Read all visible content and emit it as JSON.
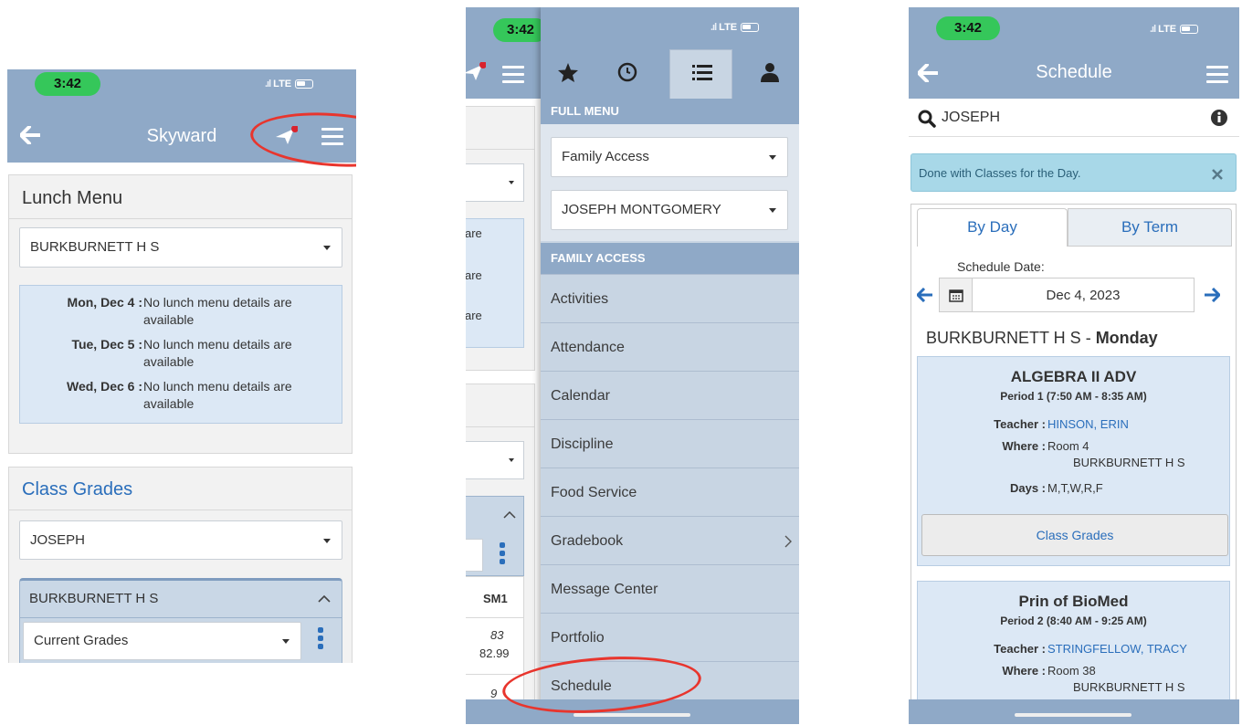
{
  "status": {
    "time": "3:42",
    "network": "LTE"
  },
  "screen1": {
    "nav_title": "Skyward",
    "lunch": {
      "title": "Lunch Menu",
      "school": "BURKBURNETT H S",
      "rows": [
        {
          "day": "Mon, Dec 4 :",
          "text": "No lunch menu details are",
          "text2": "available"
        },
        {
          "day": "Tue, Dec 5 :",
          "text": "No lunch menu details are",
          "text2": "available"
        },
        {
          "day": "Wed, Dec 6 :",
          "text": "No lunch menu details are",
          "text2": "available"
        }
      ]
    },
    "grades": {
      "title": "Class Grades",
      "student": "JOSEPH",
      "school": "BURKBURNETT H S",
      "view": "Current Grades"
    }
  },
  "screen2": {
    "behind_snippets": [
      "are",
      "are",
      "are"
    ],
    "behind_col_header": "SM1",
    "behind_cell_1": "83",
    "behind_cell_2": "82.99",
    "behind_cell_3": "9",
    "full_menu_label": "FULL MENU",
    "access_select": "Family Access",
    "student_select": "JOSEPH MONTGOMERY",
    "family_access_label": "FAMILY ACCESS",
    "items": [
      "Activities",
      "Attendance",
      "Calendar",
      "Discipline",
      "Food Service",
      "Gradebook",
      "Message Center",
      "Portfolio",
      "Schedule"
    ]
  },
  "screen3": {
    "nav_title": "Schedule",
    "search_value": "JOSEPH",
    "alert": "Done with Classes for the Day.",
    "tabs": [
      "By Day",
      "By Term"
    ],
    "date_label": "Schedule Date:",
    "date_value": "Dec 4, 2023",
    "school_day_prefix": "BURKBURNETT H S - ",
    "school_day_bold": "Monday",
    "classes": [
      {
        "name": "ALGEBRA II ADV",
        "period": "Period 1 (7:50 AM - 8:35 AM)",
        "teacher_label": "Teacher :",
        "teacher": "HINSON, ERIN",
        "where_label": "Where :",
        "room": "Room 4",
        "campus": "BURKBURNETT H S",
        "days_label": "Days :",
        "days": "M,T,W,R,F",
        "button": "Class Grades"
      },
      {
        "name": "Prin of BioMed",
        "period": "Period 2 (8:40 AM - 9:25 AM)",
        "teacher_label": "Teacher :",
        "teacher": "STRINGFELLOW, TRACY",
        "where_label": "Where :",
        "room": "Room 38",
        "campus": "BURKBURNETT H S"
      }
    ]
  },
  "colors": {
    "nav": "#8fa9c7",
    "menu_bg": "#c8d5e3",
    "link": "#2a6ebb",
    "annotation": "#e8352d",
    "highlight_panel": "#dce8f5"
  }
}
